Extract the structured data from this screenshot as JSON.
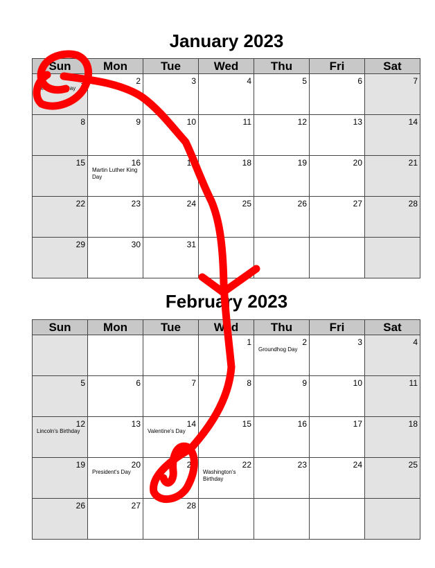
{
  "weekdays": [
    "Sun",
    "Mon",
    "Tue",
    "Wed",
    "Thu",
    "Fri",
    "Sat"
  ],
  "months": [
    {
      "title": "January 2023",
      "weeks": [
        [
          {
            "d": "1",
            "h": "New Year's Day"
          },
          {
            "d": "2"
          },
          {
            "d": "3"
          },
          {
            "d": "4"
          },
          {
            "d": "5"
          },
          {
            "d": "6"
          },
          {
            "d": "7"
          }
        ],
        [
          {
            "d": "8"
          },
          {
            "d": "9"
          },
          {
            "d": "10"
          },
          {
            "d": "11"
          },
          {
            "d": "12"
          },
          {
            "d": "13"
          },
          {
            "d": "14"
          }
        ],
        [
          {
            "d": "15"
          },
          {
            "d": "16",
            "h": "Martin Luther King Day"
          },
          {
            "d": "17"
          },
          {
            "d": "18"
          },
          {
            "d": "19"
          },
          {
            "d": "20"
          },
          {
            "d": "21"
          }
        ],
        [
          {
            "d": "22"
          },
          {
            "d": "23"
          },
          {
            "d": "24"
          },
          {
            "d": "25"
          },
          {
            "d": "26"
          },
          {
            "d": "27"
          },
          {
            "d": "28"
          }
        ],
        [
          {
            "d": "29"
          },
          {
            "d": "30"
          },
          {
            "d": "31"
          },
          {
            "d": ""
          },
          {
            "d": ""
          },
          {
            "d": ""
          },
          {
            "d": ""
          }
        ]
      ]
    },
    {
      "title": "February 2023",
      "weeks": [
        [
          {
            "d": ""
          },
          {
            "d": ""
          },
          {
            "d": ""
          },
          {
            "d": "1"
          },
          {
            "d": "2",
            "h": "Groundhog Day"
          },
          {
            "d": "3"
          },
          {
            "d": "4"
          }
        ],
        [
          {
            "d": "5"
          },
          {
            "d": "6"
          },
          {
            "d": "7"
          },
          {
            "d": "8"
          },
          {
            "d": "9"
          },
          {
            "d": "10"
          },
          {
            "d": "11"
          }
        ],
        [
          {
            "d": "12",
            "h": "Lincoln's Birthday"
          },
          {
            "d": "13"
          },
          {
            "d": "14",
            "h": "Valentine's Day"
          },
          {
            "d": "15"
          },
          {
            "d": "16"
          },
          {
            "d": "17"
          },
          {
            "d": "18"
          }
        ],
        [
          {
            "d": "19"
          },
          {
            "d": "20",
            "h": "President's Day"
          },
          {
            "d": "21"
          },
          {
            "d": "22",
            "h": "Washington's Birthday"
          },
          {
            "d": "23"
          },
          {
            "d": "24"
          },
          {
            "d": "25"
          }
        ],
        [
          {
            "d": "26"
          },
          {
            "d": "27"
          },
          {
            "d": "28"
          },
          {
            "d": ""
          },
          {
            "d": ""
          },
          {
            "d": ""
          },
          {
            "d": ""
          }
        ]
      ]
    }
  ],
  "annotation": {
    "ink_color": "#ff0000",
    "description": "hand-drawn arrow from Jan 1 to Feb 21"
  }
}
